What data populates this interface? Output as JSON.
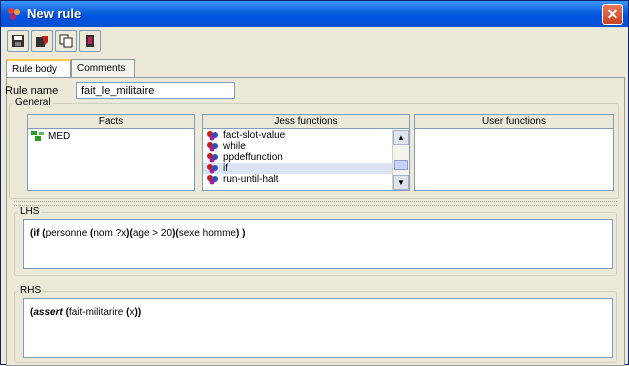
{
  "window": {
    "title": "New rule",
    "close_label": "✕"
  },
  "toolbar": {
    "buttons": [
      "save-icon",
      "edit-icon",
      "copy-icon",
      "book-icon"
    ]
  },
  "tabs": [
    {
      "label": "Rule body",
      "active": true
    },
    {
      "label": "Comments",
      "active": false
    }
  ],
  "rule_name": {
    "label": "Rule name",
    "value": "fait_le_militaire"
  },
  "general": {
    "label": "General",
    "facts": {
      "header": "Facts",
      "items": [
        "MED"
      ]
    },
    "jess_functions": {
      "header": "Jess functions",
      "items": [
        "fact-slot-value",
        "while",
        "ppdeffunction",
        "if",
        "run-until-halt"
      ],
      "selected_index": 3
    },
    "user_functions": {
      "header": "User functions",
      "items": []
    }
  },
  "lhs": {
    "label": "LHS",
    "code_parts": [
      "(",
      "if",
      " (",
      "personne",
      " (",
      "nom ?x",
      ")(",
      "age > 20",
      ")(",
      "sexe homme",
      ") )"
    ]
  },
  "rhs": {
    "label": "RHS",
    "code_parts": [
      "(",
      "assert",
      " (",
      "fait-militarire",
      " (",
      "x",
      "))"
    ]
  },
  "colors": {
    "title_bar": "#0054e3",
    "window_bg": "#ece9d8",
    "close_button": "#c8421e",
    "selection": "#dbe3f4"
  }
}
